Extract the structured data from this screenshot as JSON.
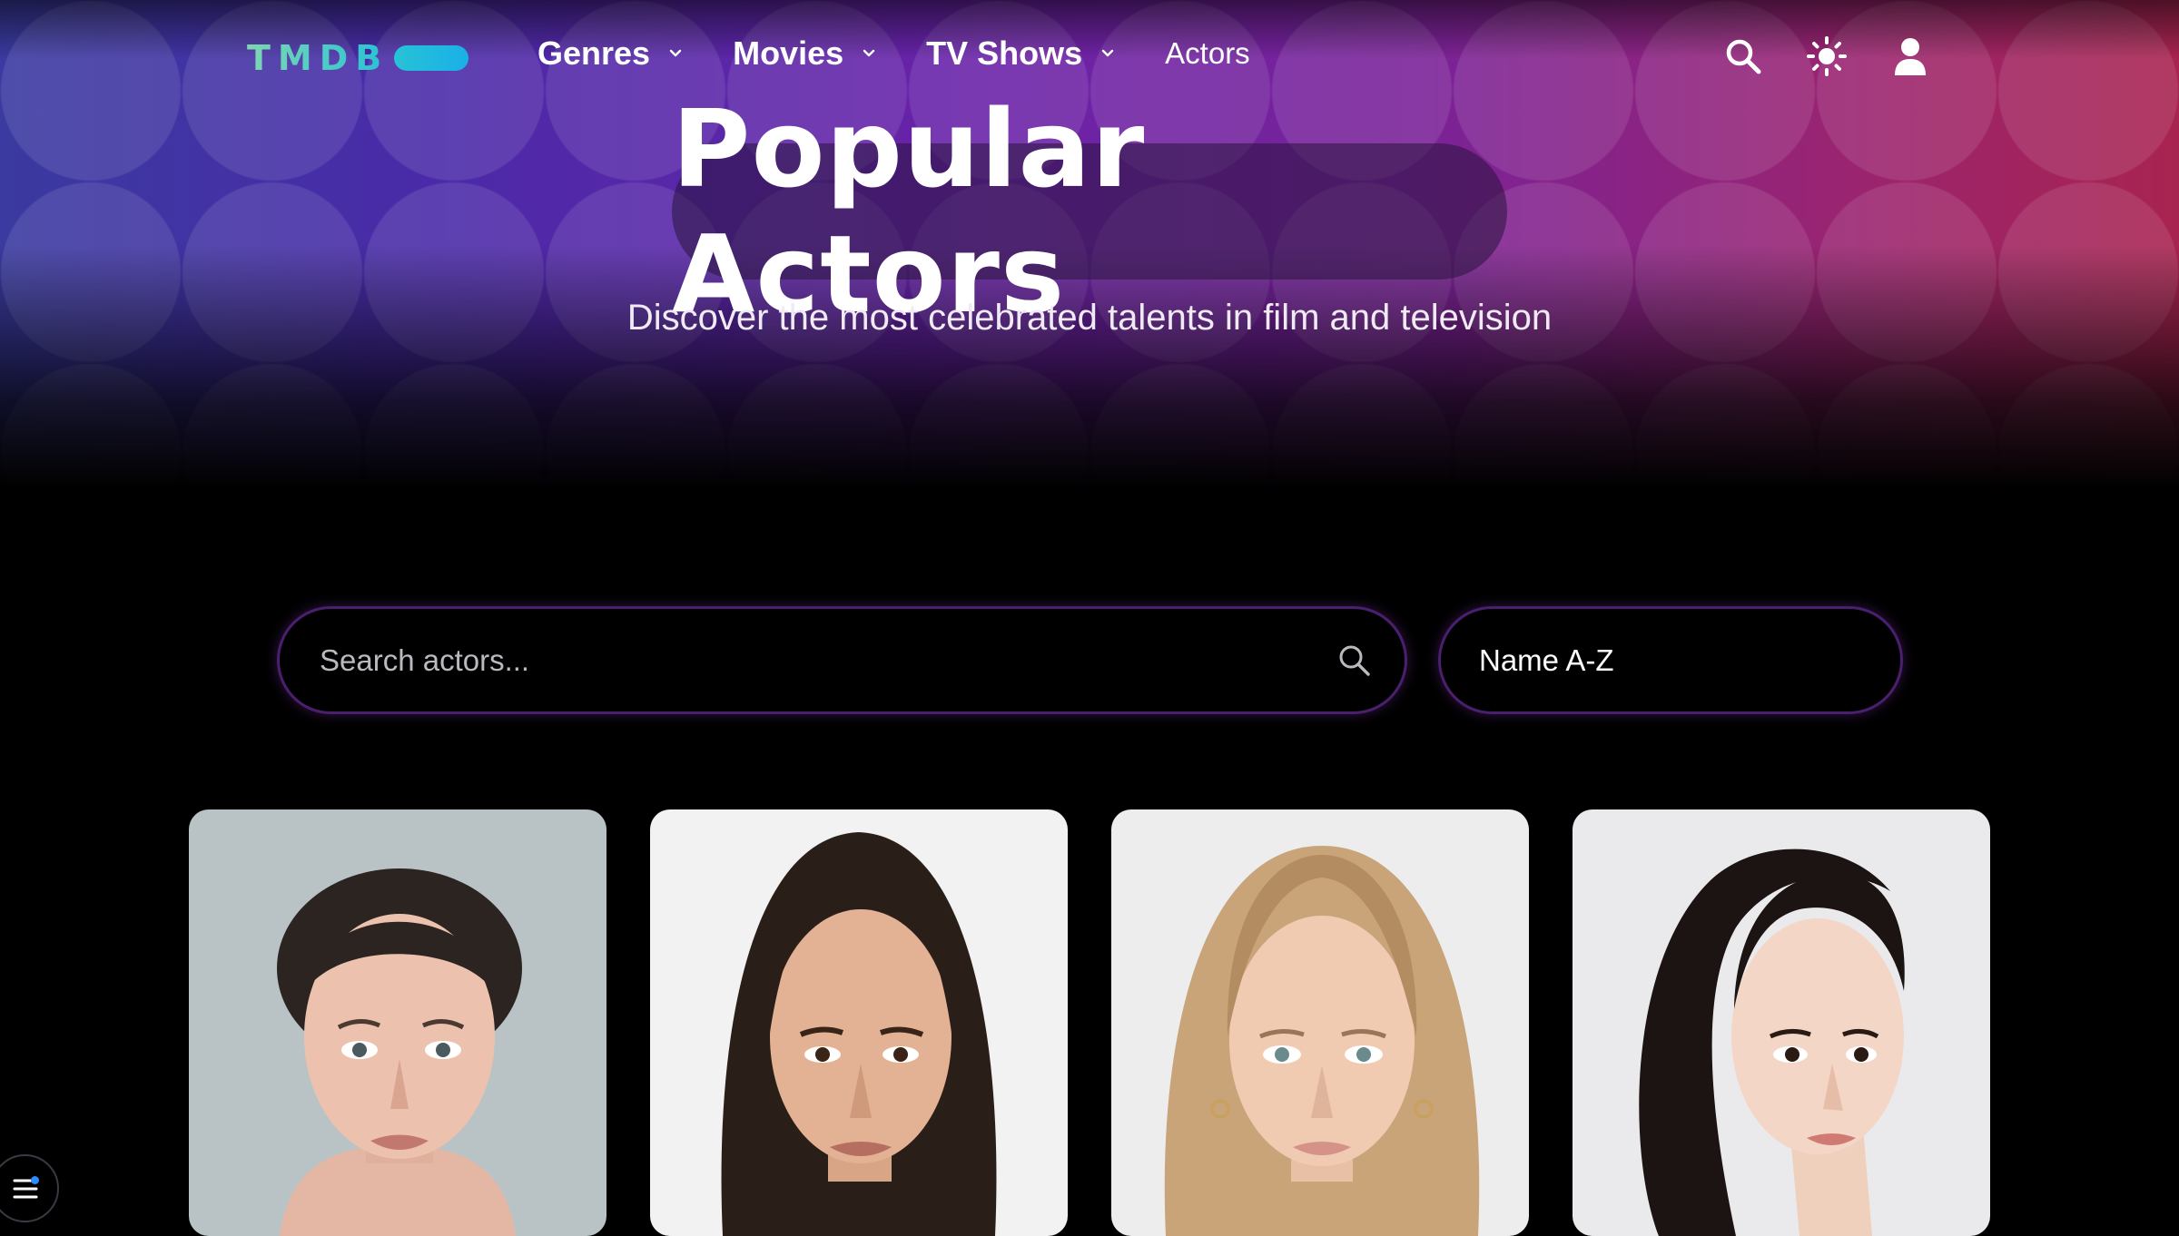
{
  "brand": {
    "logo_text": "TMDB",
    "accent": "#27c2d6"
  },
  "nav": {
    "links": [
      {
        "label": "Genres",
        "has_dropdown": true
      },
      {
        "label": "Movies",
        "has_dropdown": true
      },
      {
        "label": "TV Shows",
        "has_dropdown": true
      },
      {
        "label": "Actors",
        "has_dropdown": false
      }
    ],
    "icons": [
      "search-icon",
      "theme-toggle-icon",
      "user-icon"
    ]
  },
  "hero": {
    "title": "Popular Actors",
    "subtitle": "Discover the most celebrated talents in film and television"
  },
  "filters": {
    "search_placeholder": "Search actors...",
    "search_value": "",
    "sort_selected": "Name A-Z"
  },
  "actors": [
    {
      "photo": "actor-photo-1",
      "bg": "#b9c3c6"
    },
    {
      "photo": "actor-photo-2",
      "bg": "#f2f2f2"
    },
    {
      "photo": "actor-photo-3",
      "bg": "#ededee"
    },
    {
      "photo": "actor-photo-4",
      "bg": "#eaeaec"
    }
  ],
  "fab": {
    "icon": "menu-icon",
    "indicator_color": "#2a8cff"
  }
}
